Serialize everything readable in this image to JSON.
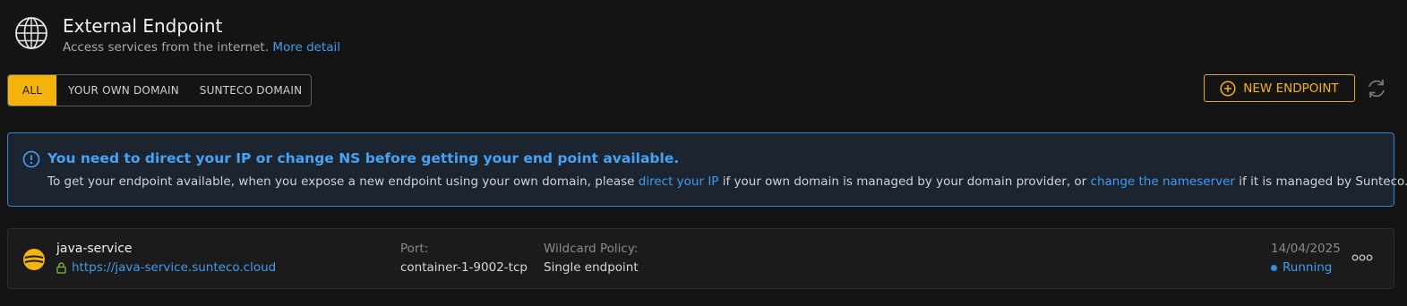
{
  "header": {
    "title": "External Endpoint",
    "subtitle": "Access services from the internet.",
    "more_link": "More detail",
    "icon": "globe-icon"
  },
  "tabs": [
    {
      "label": "ALL",
      "active": true
    },
    {
      "label": "YOUR OWN DOMAIN",
      "active": false
    },
    {
      "label": "SUNTECO DOMAIN",
      "active": false
    }
  ],
  "actions": {
    "new_endpoint_label": "NEW ENDPOINT",
    "new_icon": "plus-circle-icon",
    "refresh_icon": "refresh-icon"
  },
  "alert": {
    "title": "You need to direct your IP or change NS before getting your end point available.",
    "body_1": "To get your endpoint available, when you expose a new endpoint using your own domain, please",
    "link_1": "direct your IP",
    "body_2": "if your own domain is managed by your domain provider, or",
    "link_2": "change the nameserver",
    "body_3": "if it is managed by Sunteco.",
    "icon": "info-icon"
  },
  "endpoints": [
    {
      "name": "java-service",
      "url": "https://java-service.sunteco.cloud",
      "port_label": "Port:",
      "port": "container-1-9002-tcp",
      "policy_label": "Wildcard Policy:",
      "policy": "Single endpoint",
      "date": "14/04/2025",
      "status": "Running",
      "icon": "java-service-icon"
    }
  ],
  "colors": {
    "accent": "#f5b40b",
    "link": "#3f9cf2",
    "background": "#141414",
    "alert_border": "#2f86d1"
  }
}
